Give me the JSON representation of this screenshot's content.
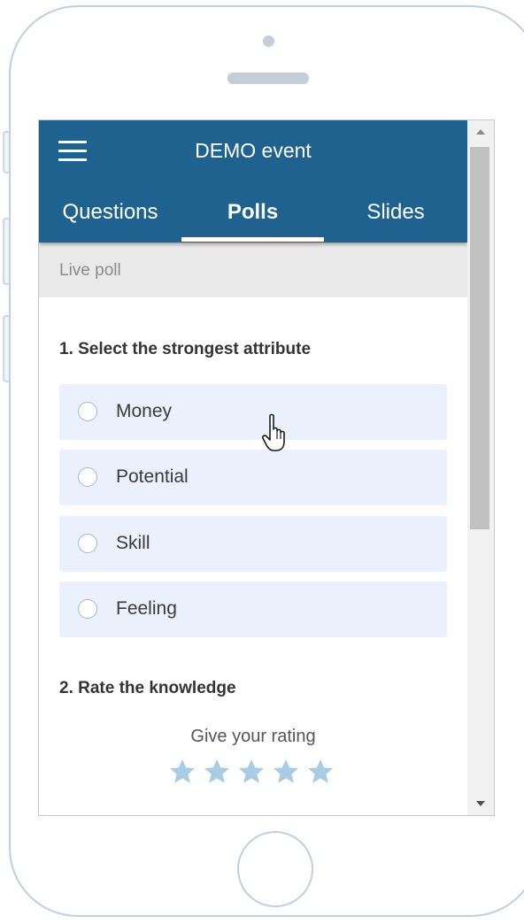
{
  "app": {
    "title": "DEMO event",
    "menu_icon": "hamburger-menu-icon"
  },
  "tabs": [
    {
      "label": "Questions",
      "active": false
    },
    {
      "label": "Polls",
      "active": true
    },
    {
      "label": "Slides",
      "active": false
    }
  ],
  "poll": {
    "status_label": "Live poll",
    "questions": [
      {
        "title": "1. Select the strongest attribute",
        "type": "single-choice",
        "options": [
          "Money",
          "Potential",
          "Skill",
          "Feeling"
        ]
      },
      {
        "title": "2. Rate the knowledge",
        "type": "rating",
        "prompt": "Give your rating",
        "max_stars": 5,
        "selected_stars": 0
      }
    ]
  },
  "colors": {
    "appbar": "#20628f",
    "option_background": "#eaf1fd",
    "star": "#a9cbe4",
    "phone_outline": "#bcd0e2"
  },
  "icons": {
    "star": "star-icon",
    "radio": "radio-unselected-icon",
    "cursor": "hand-pointer-cursor-icon"
  }
}
